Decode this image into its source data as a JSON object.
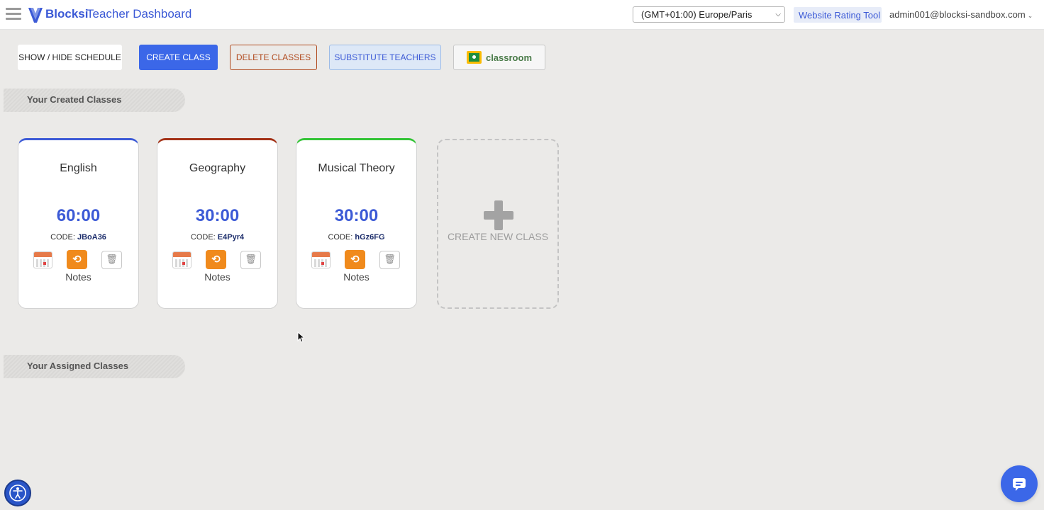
{
  "header": {
    "brand": "Blocksi",
    "title": "Teacher Dashboard",
    "timezone": "(GMT+01:00) Europe/Paris",
    "rating_tool": "Website Rating Tool",
    "user": "admin001@blocksi-sandbox.com"
  },
  "toolbar": {
    "show_hide_schedule": "SHOW / HIDE SCHEDULE",
    "create_class": "CREATE CLASS",
    "delete_classes": "DELETE CLASSES",
    "substitute_teachers": "SUBSTITUTE TEACHERS",
    "classroom": "classroom"
  },
  "sections": {
    "created": "Your Created Classes",
    "assigned": "Your Assigned Classes"
  },
  "classes": [
    {
      "name": "English",
      "time": "60:00",
      "code_label": "CODE:",
      "code": "JBoA36",
      "notes": "Notes",
      "color": "#3c5ad6"
    },
    {
      "name": "Geography",
      "time": "30:00",
      "code_label": "CODE:",
      "code": "E4Pyr4",
      "notes": "Notes",
      "color": "#a33217"
    },
    {
      "name": "Musical Theory",
      "time": "30:00",
      "code_label": "CODE:",
      "code": "hGz6FG",
      "notes": "Notes",
      "color": "#33c436"
    }
  ],
  "create_new": {
    "label": "CREATE NEW CLASS"
  },
  "colors": {
    "accent": "#3b67e8",
    "brand": "#3c5ad6",
    "reset_orange": "#f08a1c",
    "delete_border": "#b04a1e"
  },
  "icons": {
    "menu": "hamburger-icon",
    "logo": "blocksi-logo",
    "calendar": "calendar-icon",
    "reset": "reset-icon",
    "trash": "trash-icon",
    "plus": "plus-icon",
    "accessibility": "accessibility-icon",
    "chat": "chat-icon"
  }
}
